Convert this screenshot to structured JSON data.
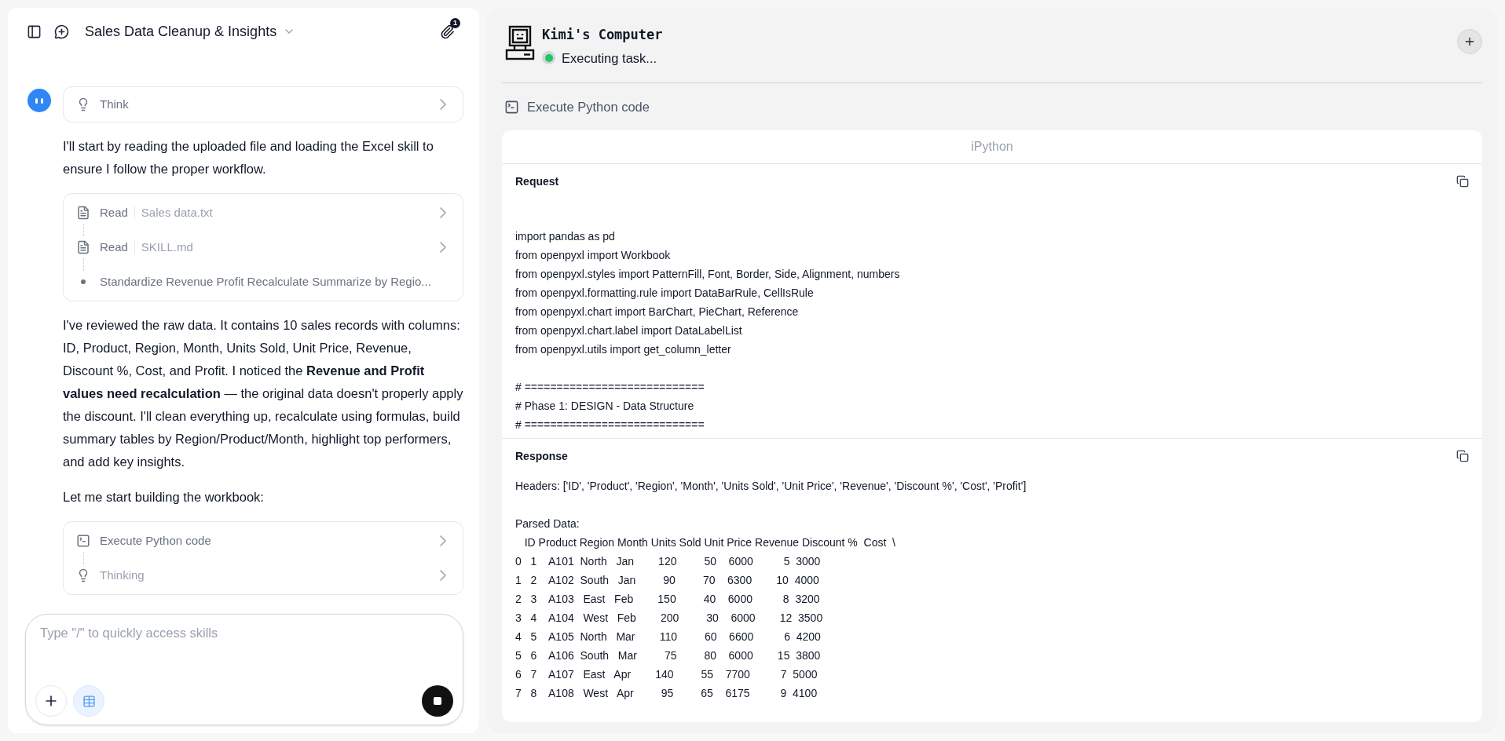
{
  "header": {
    "title": "Sales Data Cleanup & Insights",
    "attachment_count": "1"
  },
  "messages": [
    {
      "kind": "think",
      "label": "Think"
    },
    {
      "kind": "text",
      "text": "I'll start by reading the uploaded file and loading the Excel skill to ensure I follow the proper workflow."
    },
    {
      "kind": "tools",
      "items": [
        {
          "kind": "read",
          "verb": "Read",
          "target": "Sales data.txt"
        },
        {
          "kind": "read",
          "verb": "Read",
          "target": "SKILL.md"
        },
        {
          "kind": "step",
          "label": "Standardize Revenue Profit Recalculate Summarize by Regio..."
        }
      ]
    },
    {
      "kind": "text",
      "text": "I've reviewed the raw data. It contains 10 sales records with columns: ID, Product, Region, Month, Units Sold, Unit Price, Revenue, Discount %, Cost, and Profit. I noticed the **Revenue and Profit values need recalculation** — the original data doesn't properly apply the discount. I'll clean everything up, recalculate using formulas, build summary tables by Region/Product/Month, highlight top performers, and add key insights."
    },
    {
      "kind": "text",
      "text": "Let me start building the workbook:"
    },
    {
      "kind": "tools",
      "items": [
        {
          "kind": "code",
          "label": "Execute Python code"
        },
        {
          "kind": "thinking",
          "label": "Thinking"
        }
      ]
    }
  ],
  "composer": {
    "placeholder": "Type \"/\" to quickly access skills",
    "table_mode": true
  },
  "computer": {
    "title": "Kimi's Computer",
    "status": "Executing task...",
    "running": true,
    "tool_label": "Execute Python code",
    "panel_title": "iPython",
    "sections": [
      {
        "title": "Request",
        "body": "import pandas as pd\nfrom openpyxl import Workbook\nfrom openpyxl.styles import PatternFill, Font, Border, Side, Alignment, numbers\nfrom openpyxl.formatting.rule import DataBarRule, CellIsRule\nfrom openpyxl.chart import BarChart, PieChart, Reference\nfrom openpyxl.chart.label import DataLabelList\nfrom openpyxl.utils import get_column_letter\n\n# ============================\n# Phase 1: DESIGN - Data Structure\n# ============================"
      },
      {
        "title": "Response",
        "body": "Headers: ['ID', 'Product', 'Region', 'Month', 'Units Sold', 'Unit Price', 'Revenue', 'Discount %', 'Cost', 'Profit']\n\nParsed Data:\n   ID Product Region Month Units Sold Unit Price Revenue Discount %  Cost  \\\n0   1    A101  North   Jan        120         50    6000          5  3000\n1   2    A102  South   Jan         90         70    6300        10  4000\n2   3    A103   East   Feb        150         40    6000          8  3200\n3   4    A104   West   Feb        200         30    6000        12  3500\n4   5    A105  North   Mar        110         60    6600          6  4200\n5   6    A106  South   Mar         75         80    6000        15  3800\n6   7    A107   East   Apr        140         55    7700          7  5000\n7   8    A108   West   Apr         95         65    6175          9  4100"
      }
    ]
  }
}
